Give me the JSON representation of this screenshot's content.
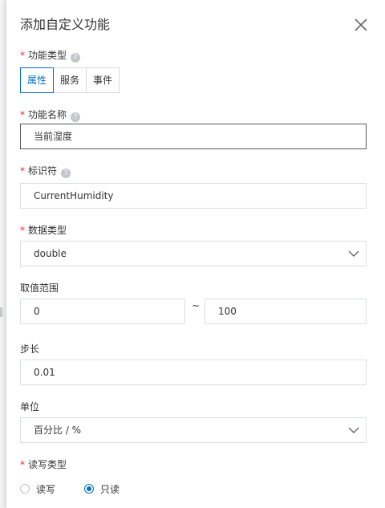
{
  "dialog": {
    "title": "添加自定义功能"
  },
  "function_type": {
    "label": "功能类型",
    "options": [
      "属性",
      "服务",
      "事件"
    ],
    "selected": "属性"
  },
  "function_name": {
    "label": "功能名称",
    "value": "当前湿度"
  },
  "identifier": {
    "label": "标识符",
    "value": "CurrentHumidity"
  },
  "data_type": {
    "label": "数据类型",
    "value": "double"
  },
  "range": {
    "label": "取值范围",
    "min": "0",
    "separator": "~",
    "max": "100"
  },
  "step": {
    "label": "步长",
    "value": "0.01"
  },
  "unit": {
    "label": "单位",
    "value": "百分比 / %"
  },
  "access": {
    "label": "读写类型",
    "options": [
      "读写",
      "只读"
    ],
    "selected": "只读"
  },
  "colors": {
    "accent": "#0070cc",
    "required": "#f5222d",
    "border": "#dcdfe6"
  },
  "icons": {
    "close": "close-icon",
    "help": "help-icon",
    "dropdown": "chevron-down-icon"
  }
}
